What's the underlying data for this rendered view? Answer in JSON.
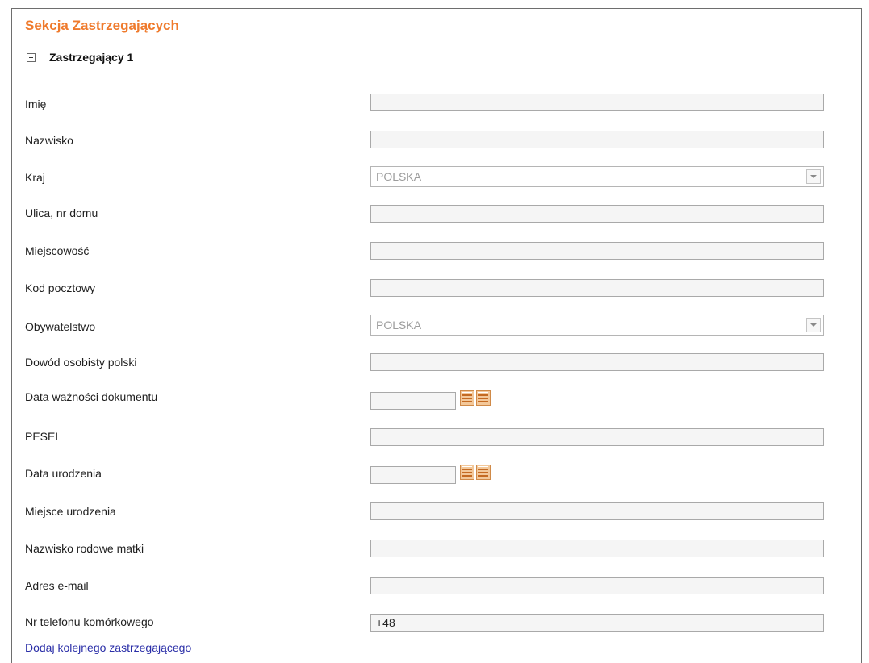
{
  "section": {
    "title": "Sekcja Zastrzegających"
  },
  "group": {
    "title": "Zastrzegający 1",
    "icon": "collapse-minus-icon"
  },
  "fields": {
    "imie": {
      "label": "Imię",
      "value": ""
    },
    "nazwisko": {
      "label": "Nazwisko",
      "value": ""
    },
    "kraj": {
      "label": "Kraj",
      "value": "POLSKA"
    },
    "ulica": {
      "label": "Ulica, nr domu",
      "value": ""
    },
    "miejscowosc": {
      "label": "Miejscowość",
      "value": ""
    },
    "kod_pocztowy": {
      "label": "Kod pocztowy",
      "value": ""
    },
    "obywatelstwo": {
      "label": "Obywatelstwo",
      "value": "POLSKA"
    },
    "dowod": {
      "label": "Dowód osobisty polski",
      "value": ""
    },
    "data_waznosci": {
      "label": "Data ważności dokumentu",
      "value": ""
    },
    "pesel": {
      "label": "PESEL",
      "value": ""
    },
    "data_urodzenia": {
      "label": "Data urodzenia",
      "value": ""
    },
    "miejsce_urodzenia": {
      "label": "Miejsce urodzenia",
      "value": ""
    },
    "nazwisko_matki": {
      "label": "Nazwisko rodowe matki",
      "value": ""
    },
    "email": {
      "label": "Adres e-mail",
      "value": ""
    },
    "telefon": {
      "label": "Nr telefonu komórkowego",
      "value": "+48"
    }
  },
  "actions": {
    "add_another": "Dodaj kolejnego zastrzegającego"
  },
  "colors": {
    "section_title": "#ef7a2c",
    "link": "#2b2fa8",
    "input_border": "#a9a9a9",
    "input_bg": "#f5f5f5"
  }
}
